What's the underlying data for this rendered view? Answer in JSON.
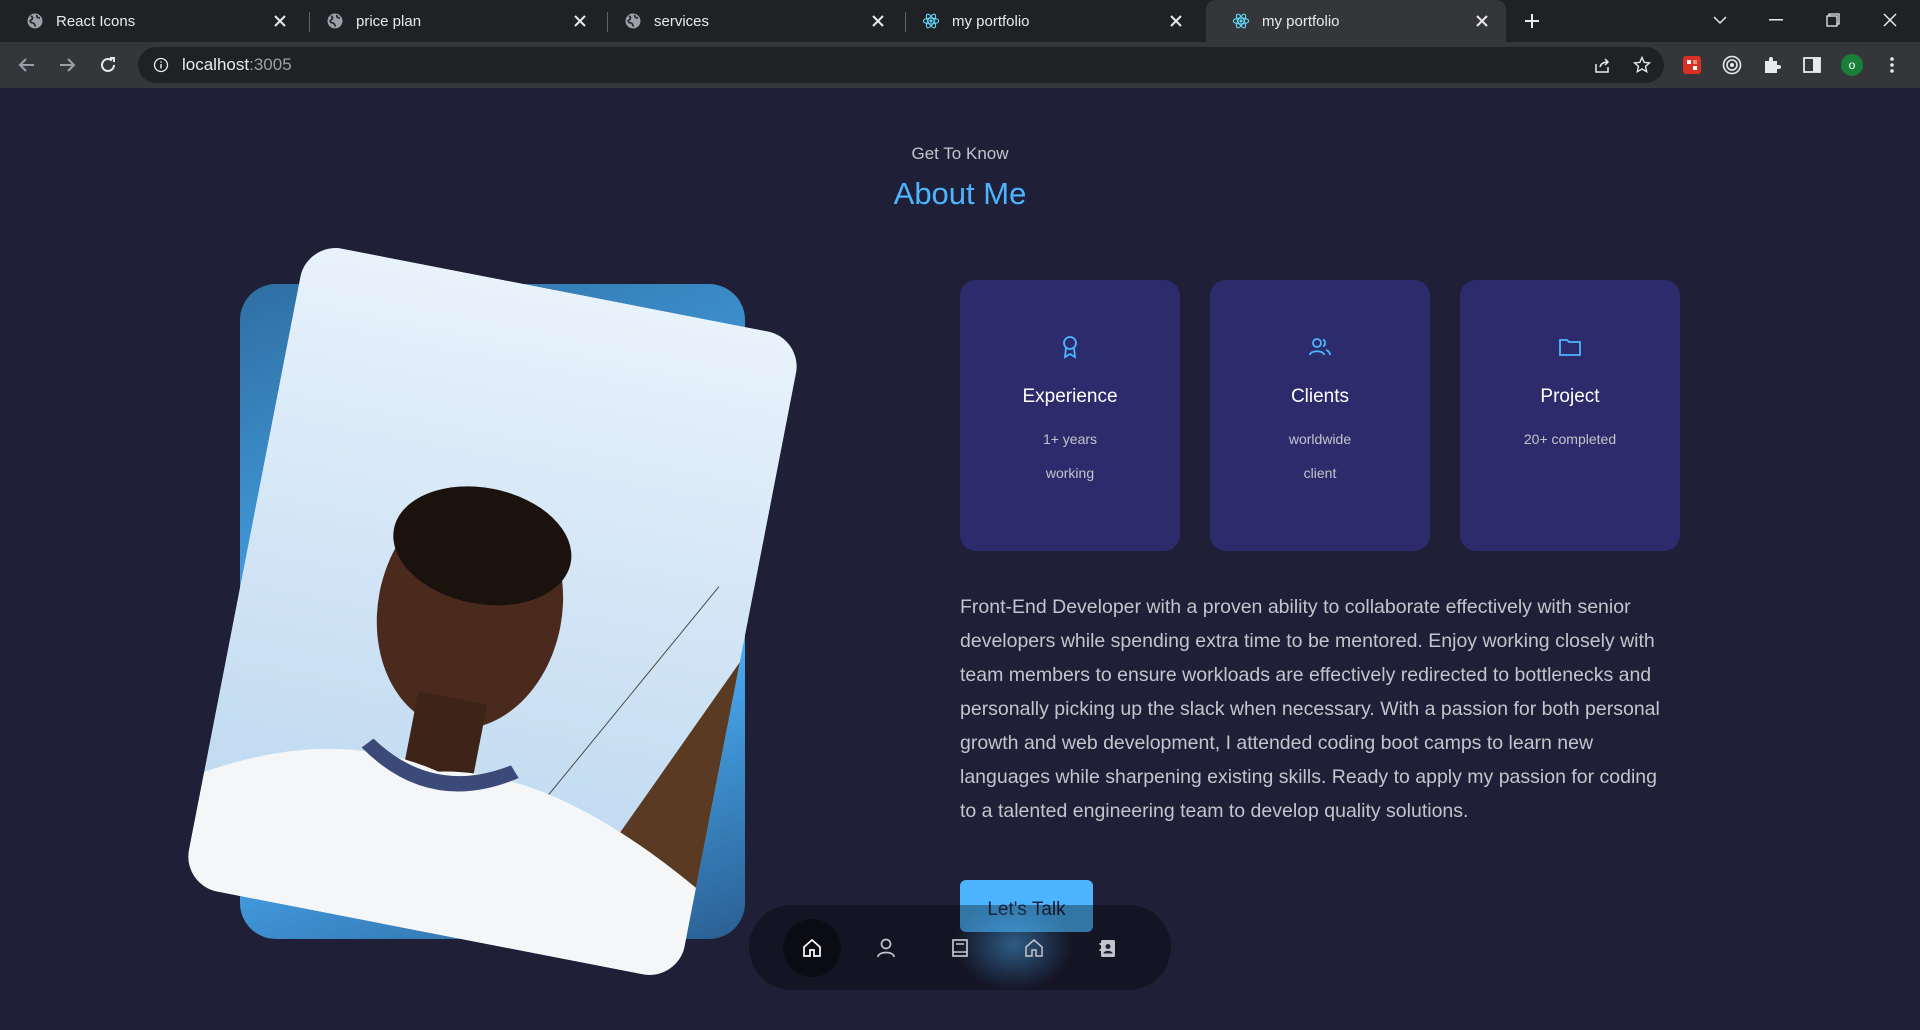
{
  "browser": {
    "tabs": [
      {
        "title": "React Icons",
        "favicon": "globe-icon",
        "active": false
      },
      {
        "title": "price plan",
        "favicon": "globe-icon",
        "active": false
      },
      {
        "title": "services",
        "favicon": "globe-icon",
        "active": false
      },
      {
        "title": "my portfolio",
        "favicon": "react-icon",
        "active": false
      },
      {
        "title": "my portfolio",
        "favicon": "react-icon",
        "active": true
      }
    ],
    "address": {
      "host": "localhost",
      "port": ":3005"
    },
    "profile_initial": "o",
    "extensions": [
      "red-extension-icon",
      "target-extension-icon",
      "puzzle-icon",
      "side-panel-icon"
    ]
  },
  "about": {
    "kicker": "Get To Know",
    "title": "About Me",
    "photo": "portrait-photo",
    "cards": [
      {
        "icon": "award-icon",
        "title": "Experience",
        "lines": [
          "1+ years",
          "working"
        ]
      },
      {
        "icon": "users-icon",
        "title": "Clients",
        "lines": [
          "worldwide",
          "client"
        ]
      },
      {
        "icon": "folder-icon",
        "title": "Project",
        "lines": [
          "20+ completed"
        ]
      }
    ],
    "bio_lines": [
      "Front-End Developer with a proven ability to collaborate effectively with senior",
      "developers while spending extra time to be mentored. Enjoy working closely with",
      "team members to ensure workloads are effectively redirected to bottlenecks and",
      "personally picking up the slack when necessary. With a passion for both personal",
      "growth and web development, I attended coding boot camps to learn new",
      "languages while sharpening existing skills. Ready to apply my passion for coding",
      "to a talented engineering team to develop quality solutions."
    ],
    "cta": "Let's Talk"
  },
  "bottom_nav": [
    {
      "icon": "home-icon",
      "active": true
    },
    {
      "icon": "user-icon",
      "active": false
    },
    {
      "icon": "book-icon",
      "active": false
    },
    {
      "icon": "home-outline-icon",
      "active": false
    },
    {
      "icon": "contact-icon",
      "active": false
    }
  ],
  "colors": {
    "background": "#1f1f38",
    "accent": "#4db5ff",
    "card": "#2c2c6c",
    "text_muted": "#c4c4cc"
  }
}
